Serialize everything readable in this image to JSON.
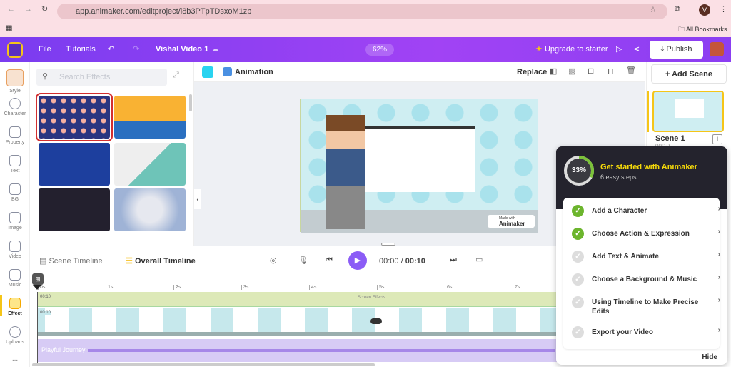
{
  "browser": {
    "url": "app.animaker.com/editproject/l8b3PTpTDsxoM1zb",
    "bookmarks": "All Bookmarks",
    "profile": "V"
  },
  "header": {
    "file": "File",
    "tutorials": "Tutorials",
    "project": "Vishal Video 1",
    "zoom": "62%",
    "upgrade": "Upgrade to starter",
    "publish": "Publish"
  },
  "rail": [
    {
      "label": "Style"
    },
    {
      "label": "Character"
    },
    {
      "label": "Property"
    },
    {
      "label": "Text"
    },
    {
      "label": "BG"
    },
    {
      "label": "Image"
    },
    {
      "label": "Video"
    },
    {
      "label": "Music"
    },
    {
      "label": "Effect",
      "active": true
    },
    {
      "label": "Uploads"
    },
    {
      "label": "..."
    }
  ],
  "panel": {
    "search_placeholder": "Search Effects"
  },
  "toolbar": {
    "animation": "Animation",
    "replace": "Replace",
    "color": "#29d3f0"
  },
  "stage": {
    "watermark_small": "Made with",
    "watermark": "Animaker"
  },
  "scenes": {
    "add": "+ Add Scene",
    "scene_name": "Scene 1",
    "scene_time": "00:10"
  },
  "timeline": {
    "scene_tab": "Scene Timeline",
    "overall_tab": "Overall Timeline",
    "current": "00:00",
    "sep": " / ",
    "total": "00:10",
    "ticks": [
      "0s",
      "1s",
      "2s",
      "3s",
      "4s",
      "5s",
      "6s",
      "7s"
    ],
    "effects_time": "00:10",
    "effects_label": "Screen Effects",
    "scene_time": "00:10",
    "audio_label": "Playful Journey"
  },
  "onboarding": {
    "percent": "33%",
    "progress": 33,
    "title": "Get started with Animaker",
    "subtitle": "6 easy steps",
    "steps": [
      {
        "label": "Add a Character",
        "done": true
      },
      {
        "label": "Choose Action & Expression",
        "done": true
      },
      {
        "label": "Add Text & Animate",
        "done": false
      },
      {
        "label": "Choose a Background & Music",
        "done": false
      },
      {
        "label": "Using Timeline to Make Precise Edits",
        "done": false
      },
      {
        "label": "Export your Video",
        "done": false
      }
    ],
    "hide": "Hide"
  },
  "colors": {
    "header": "#8b3ef2",
    "accent": "#8b5cf6",
    "success": "#6cb52d",
    "title": "#f5d90a"
  }
}
